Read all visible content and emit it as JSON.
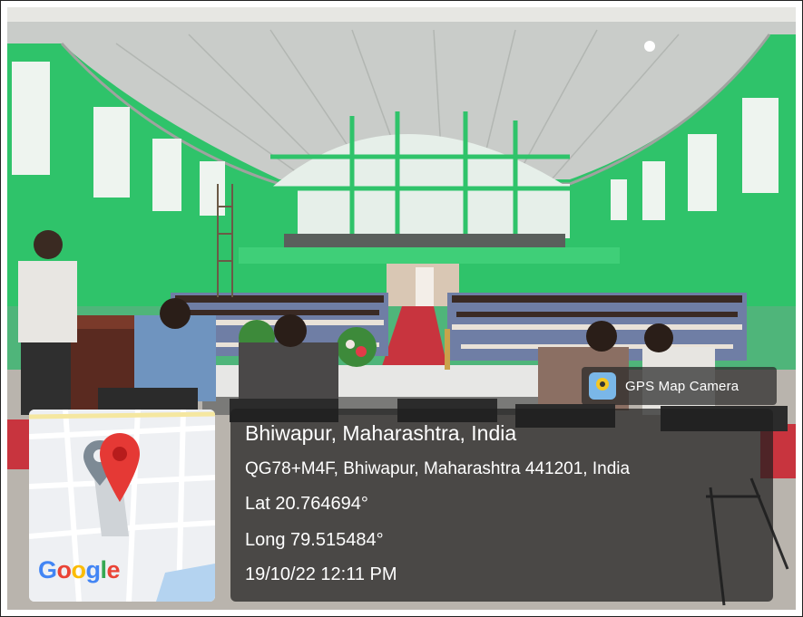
{
  "overlay": {
    "app_badge": "GPS Map Camera",
    "place": "Bhiwapur, Maharashtra, India",
    "address": "QG78+M4F, Bhiwapur, Maharashtra 441201, India",
    "latitude": "Lat 20.764694°",
    "longitude": "Long 79.515484°",
    "datetime": "19/10/22 12:11 PM"
  },
  "map": {
    "logo_letters": [
      "G",
      "o",
      "o",
      "g",
      "l",
      "e"
    ],
    "pin_color": "#e53935"
  },
  "colors": {
    "wall_green": "#2fc36a",
    "roof_grey": "#c9ccc9",
    "carpet_red": "#c8343e"
  },
  "icons": [
    "gps-map-camera-icon",
    "map-pin-icon",
    "location-marker-icon"
  ]
}
